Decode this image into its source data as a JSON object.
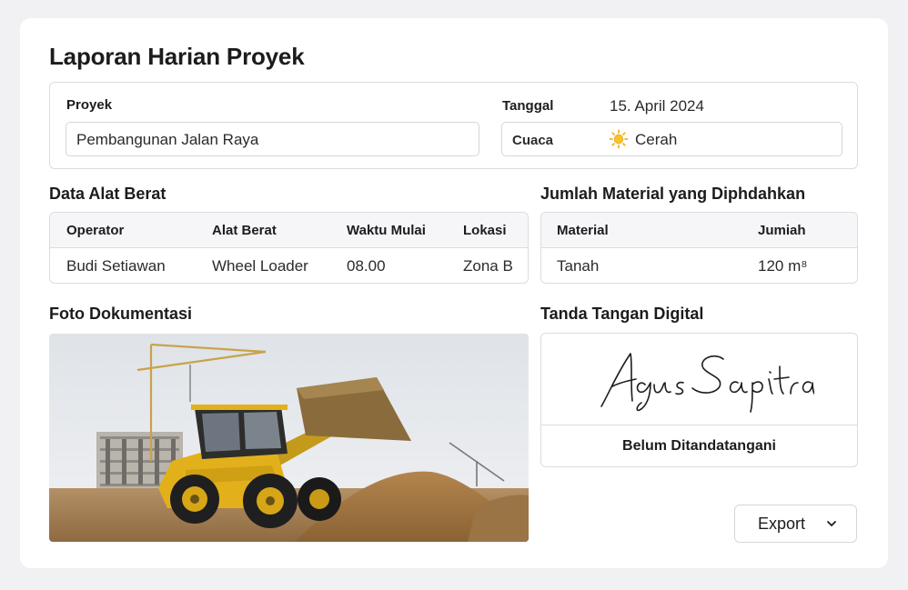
{
  "page": {
    "title": "Laporan Harian Proyek"
  },
  "project_info": {
    "project_label": "Proyek",
    "project_value": "Pembangunan Jalan Raya",
    "date_label": "Tanggal",
    "date_value": "15. April 2024",
    "weather_label": "Cuaca",
    "weather_icon": "sun-icon",
    "weather_value": "Cerah"
  },
  "equipment": {
    "title": "Data Alat Berat",
    "columns": [
      "Operator",
      "Alat Berat",
      "Waktu Mulai",
      "Lokasi"
    ],
    "rows": [
      [
        "Budi Setiawan",
        "Wheel Loader",
        "08.00",
        "Zona B"
      ]
    ]
  },
  "materials": {
    "title": "Jumlah Material yang Diphdahkan",
    "columns": [
      "Material",
      "Jumiah"
    ],
    "rows": [
      [
        "Tanah",
        "120 m⁸"
      ]
    ]
  },
  "photo": {
    "title": "Foto Dokumentasi"
  },
  "signature": {
    "title": "Tanda Tangan Digital",
    "signer_name": "Agus Sapitra",
    "status": "Belum Ditandatangani"
  },
  "actions": {
    "export_label": "Export"
  },
  "colors": {
    "sun": "#f5b21b",
    "loader": "#e2b01a",
    "soil": "#a47a43"
  }
}
